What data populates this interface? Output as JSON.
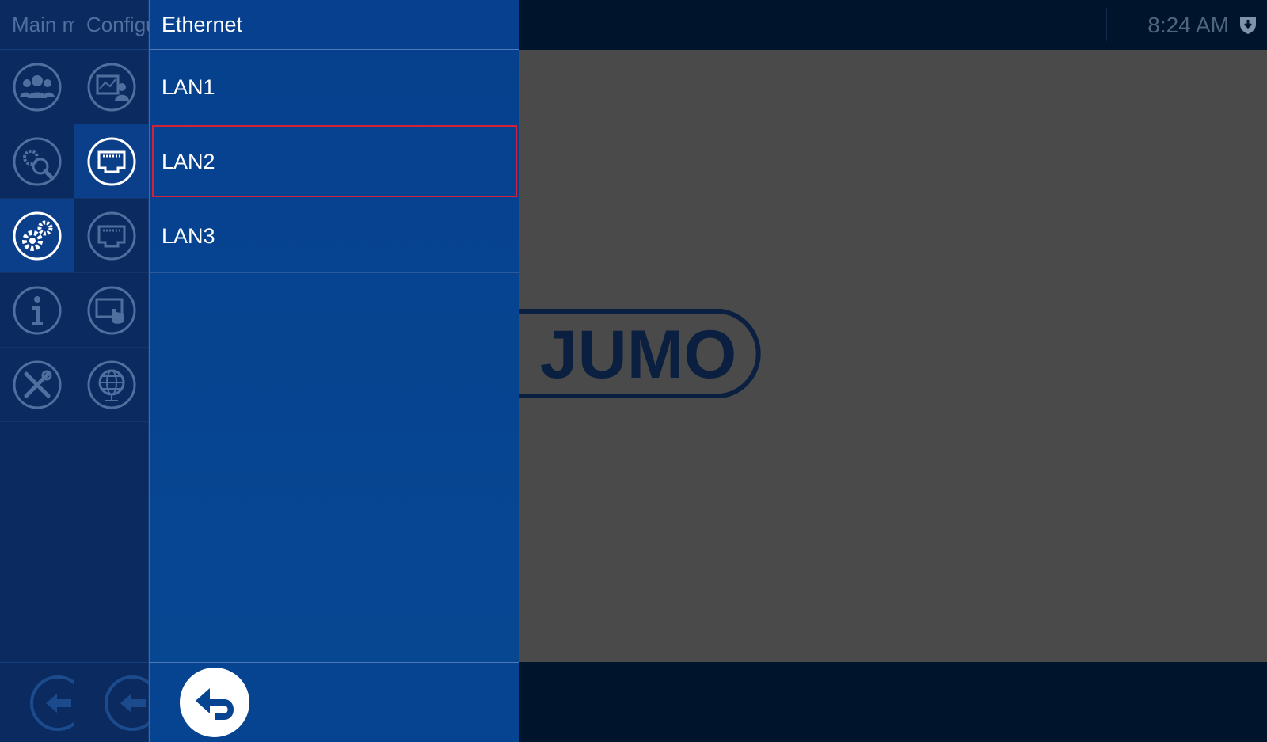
{
  "status": {
    "time": "8:24 AM",
    "icon": "shield-download-icon"
  },
  "nav": {
    "col1_title": "Main menu",
    "col2_title": "Configuration",
    "col1_items": [
      {
        "icon": "user-group-icon"
      },
      {
        "icon": "gear-search-icon"
      },
      {
        "icon": "gears-icon",
        "selected": true
      },
      {
        "icon": "info-icon"
      },
      {
        "icon": "tools-icon"
      }
    ],
    "col2_items": [
      {
        "icon": "chart-user-icon"
      },
      {
        "icon": "ethernet-port-icon",
        "selected": true
      },
      {
        "icon": "ethernet-port-icon"
      },
      {
        "icon": "touch-screen-icon"
      },
      {
        "icon": "globe-icon"
      }
    ]
  },
  "panel": {
    "title": "Ethernet",
    "items": [
      "LAN1",
      "LAN2",
      "LAN3"
    ],
    "focused_item": "LAN2"
  },
  "branding": {
    "logo_text": "JUMO"
  },
  "colors": {
    "panel_blue": "#064391",
    "focus_red": "#d4213a",
    "nav_dark": "#0b2b60"
  }
}
